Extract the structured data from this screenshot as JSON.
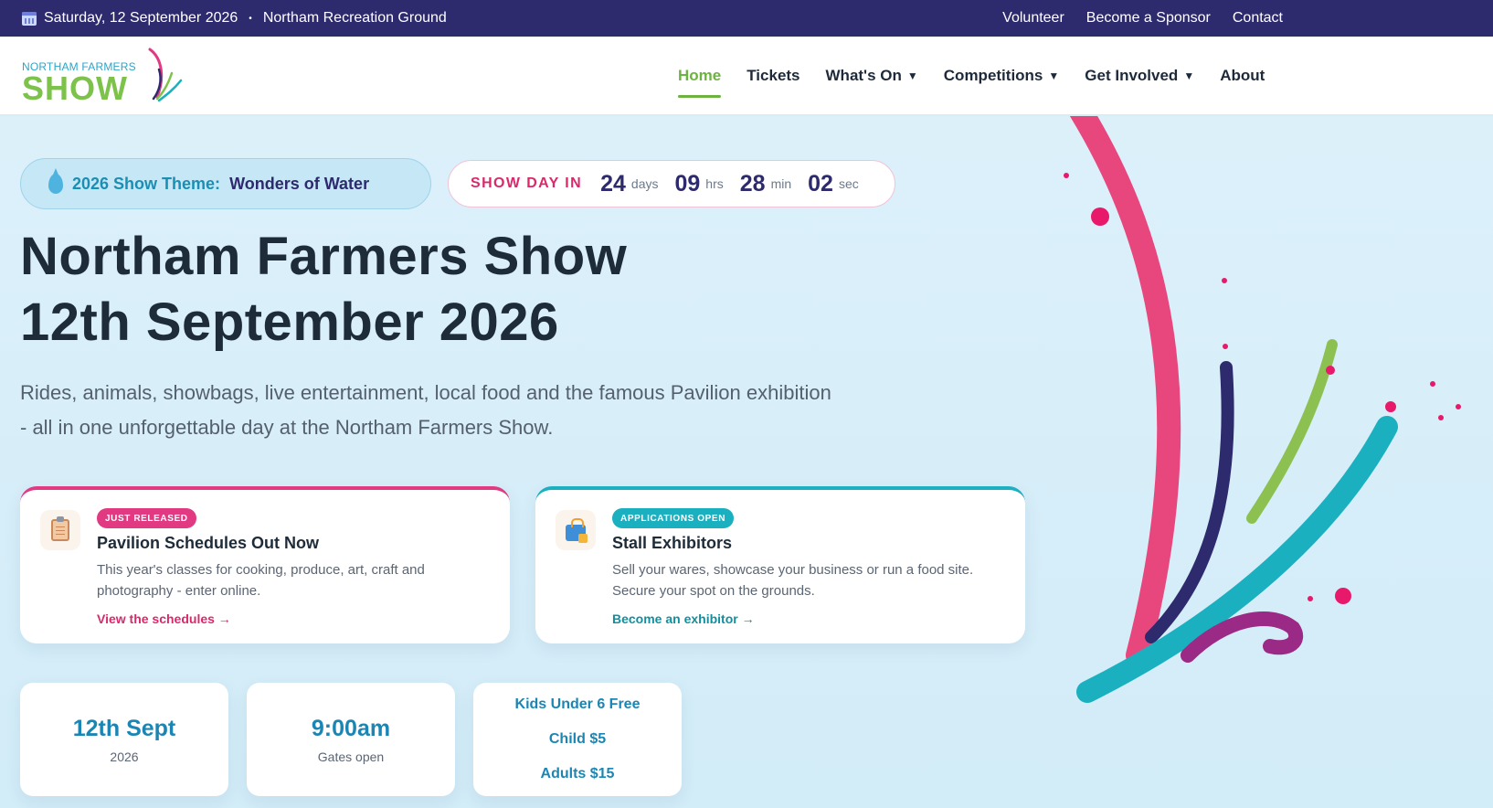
{
  "topbar": {
    "date": "Saturday, 12 September 2026",
    "separator": "•",
    "venue": "Northam Recreation Ground",
    "links": [
      "Volunteer",
      "Become a Sponsor",
      "Contact"
    ]
  },
  "logo": {
    "small": "NORTHAM FARMERS",
    "big": "SHOW"
  },
  "nav": {
    "home": "Home",
    "tickets": "Tickets",
    "whats_on": "What's On",
    "competitions": "Competitions",
    "get_involved": "Get Involved",
    "about": "About",
    "caret": "▼"
  },
  "theme": {
    "label": "2026 Show Theme:",
    "value": "Wonders of Water"
  },
  "countdown": {
    "label": "SHOW DAY IN",
    "days": "24",
    "days_unit": "days",
    "hrs": "09",
    "hrs_unit": "hrs",
    "min": "28",
    "min_unit": "min",
    "sec": "02",
    "sec_unit": "sec"
  },
  "hero": {
    "title_line1": "Northam Farmers Show",
    "title_line2": "12th September 2026",
    "lead": "Rides, animals, showbags, live entertainment, local food and the famous Pavilion exhibition - all in one unforgettable day at the Northam Farmers Show."
  },
  "cards": [
    {
      "badge": "JUST RELEASED",
      "title": "Pavilion Schedules Out Now",
      "desc": "This year's classes for cooking, produce, art, craft and photography - enter online.",
      "link": "View the schedules →",
      "icon": "clipboard-icon"
    },
    {
      "badge": "APPLICATIONS OPEN",
      "title": "Stall Exhibitors",
      "desc": "Sell your wares, showcase your business or run a food site. Secure your spot on the grounds.",
      "link": "Become an exhibitor →",
      "icon": "shopping-bag-icon"
    }
  ],
  "stats": {
    "date_value": "12th Sept",
    "date_label": "2026",
    "time_value": "9:00am",
    "time_label": "Gates open",
    "prices": [
      "Kids Under 6 Free",
      "Child $5",
      "Adults $15"
    ]
  },
  "colors": {
    "topbar_bg": "#2d2a6e",
    "accent_green": "#6cb33f",
    "accent_pink": "#e23a82",
    "accent_teal": "#1ab0c0",
    "heading": "#1e2b38"
  }
}
